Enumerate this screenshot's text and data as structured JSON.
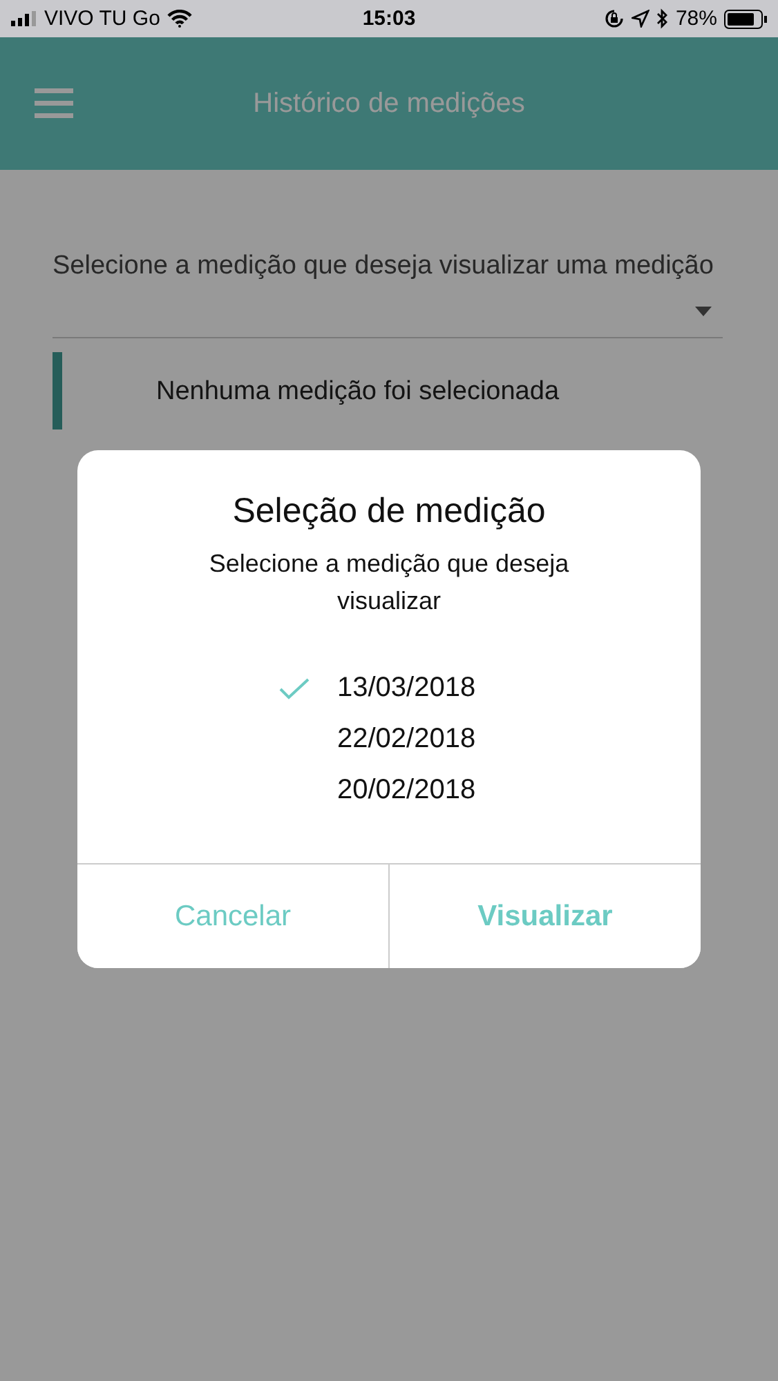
{
  "status_bar": {
    "carrier": "VIVO TU Go",
    "time": "15:03",
    "battery": "78%"
  },
  "header": {
    "title": "Histórico de medições"
  },
  "form": {
    "prompt": "Selecione a medição que deseja visualizar uma medição",
    "selection_message": "Nenhuma medição foi selecionada"
  },
  "dialog": {
    "title": "Seleção de medição",
    "message": "Selecione a medição que deseja visualizar",
    "options": [
      {
        "label": "13/03/2018",
        "selected": true
      },
      {
        "label": "22/02/2018",
        "selected": false
      },
      {
        "label": "20/02/2018",
        "selected": false
      }
    ],
    "buttons": [
      {
        "label": "Cancelar",
        "kind": "cancel"
      },
      {
        "label": "Visualizar",
        "kind": "primary"
      }
    ]
  }
}
